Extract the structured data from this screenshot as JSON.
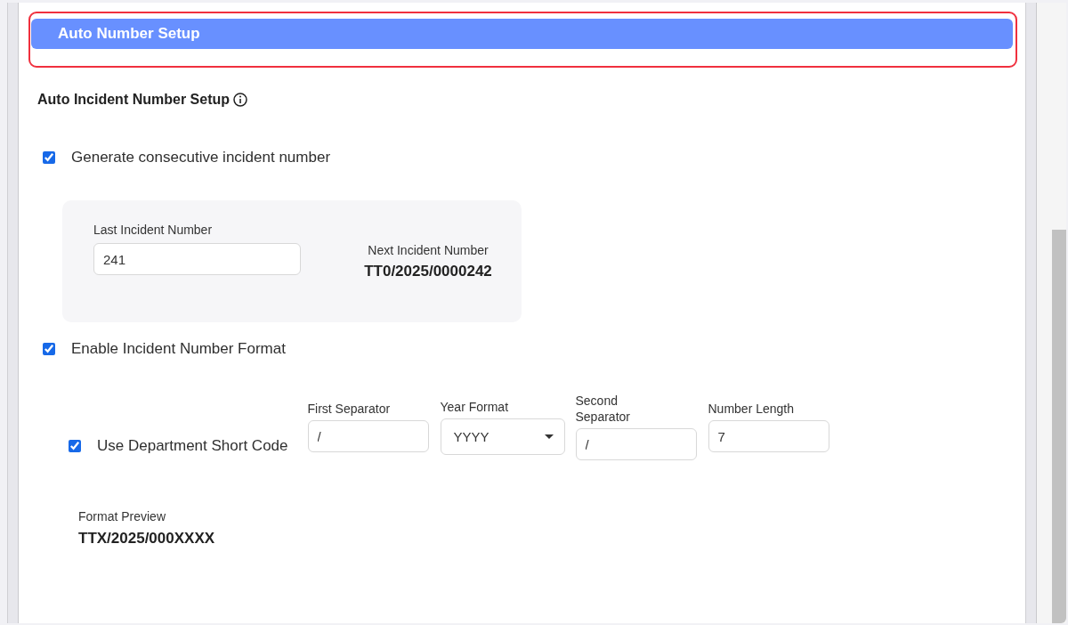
{
  "section_header": {
    "title": "Auto Number Setup",
    "highlighted": true
  },
  "subsection": {
    "title": "Auto Incident Number Setup"
  },
  "consecutive": {
    "label": "Generate consecutive incident number",
    "checked": true,
    "last_number": {
      "label": "Last Incident Number",
      "value": "241"
    },
    "next_number": {
      "label": "Next Incident Number",
      "value": "TT0/2025/0000242"
    }
  },
  "format": {
    "label": "Enable Incident Number Format",
    "checked": true,
    "department_code": {
      "label": "Use Department Short Code",
      "checked": true
    },
    "fields": [
      {
        "kind": "text",
        "label": "First Separator",
        "value": "/"
      },
      {
        "kind": "select",
        "label": "Year Format",
        "value": "YYYY"
      },
      {
        "kind": "text",
        "label": "Second Separator",
        "value": "/"
      },
      {
        "kind": "text",
        "label": "Number Length",
        "value": "7"
      }
    ],
    "preview": {
      "label": "Format Preview",
      "value": "TTX/2025/000XXXX"
    }
  }
}
